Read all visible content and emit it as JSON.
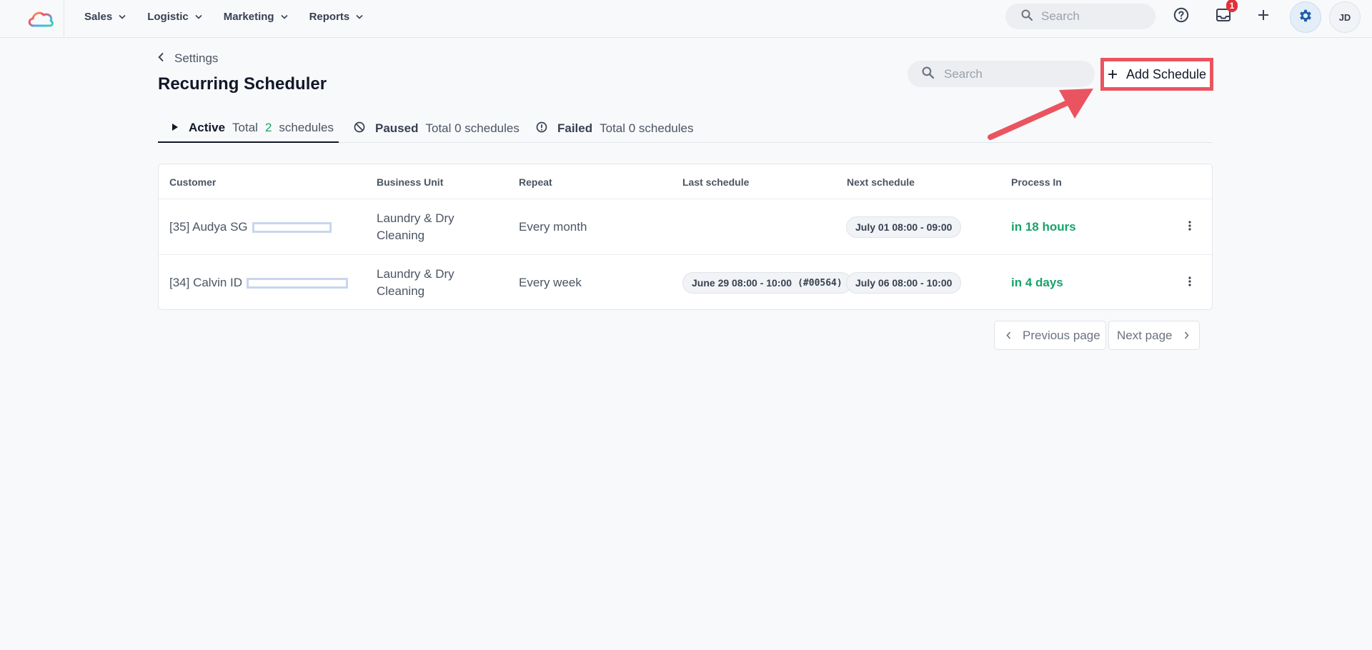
{
  "nav": {
    "menu": [
      {
        "label": "Sales"
      },
      {
        "label": "Logistic"
      },
      {
        "label": "Marketing"
      },
      {
        "label": "Reports"
      }
    ],
    "search_placeholder": "Search",
    "inbox_badge": "1",
    "avatar_initials": "JD"
  },
  "header": {
    "back_label": "Settings",
    "title": "Recurring Scheduler",
    "search_placeholder": "Search",
    "add_button_label": "Add Schedule"
  },
  "tabs": [
    {
      "label": "Active",
      "total_prefix": "Total",
      "count": "2",
      "suffix": "schedules"
    },
    {
      "label": "Paused",
      "summary": "Total 0 schedules"
    },
    {
      "label": "Failed",
      "summary": "Total 0 schedules"
    }
  ],
  "table": {
    "columns": [
      "Customer",
      "Business Unit",
      "Repeat",
      "Last schedule",
      "Next schedule",
      "Process In"
    ],
    "rows": [
      {
        "customer": "[35] Audya SG",
        "business_unit_1": "Laundry & Dry",
        "business_unit_2": "Cleaning",
        "repeat": "Every month",
        "last_schedule": "",
        "last_ref": "",
        "next_schedule": "July 01 08:00 - 09:00",
        "process_in": "in 18 hours"
      },
      {
        "customer": "[34] Calvin ID",
        "business_unit_1": "Laundry & Dry",
        "business_unit_2": "Cleaning",
        "repeat": "Every week",
        "last_schedule": "June 29 08:00 - 10:00",
        "last_ref": "(#00564)",
        "next_schedule": "July 06 08:00 - 10:00",
        "process_in": "in 4 days"
      }
    ]
  },
  "pagination": {
    "prev_label": "Previous page",
    "next_label": "Next page"
  },
  "colors": {
    "accent_green": "#16a36a",
    "highlight_red": "#ea5460",
    "badge_red": "#e0303a",
    "settings_blue": "#1f5fa8"
  }
}
